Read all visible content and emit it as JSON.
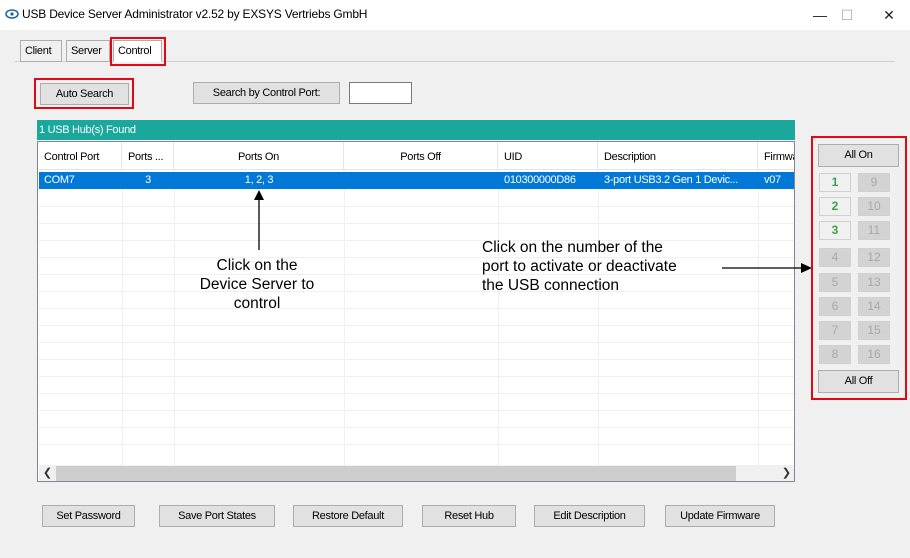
{
  "window": {
    "title": "USB Device Server Administrator v2.52 by EXSYS Vertriebs GmbH",
    "minimize": "—",
    "maximize": "☐",
    "close": "✕"
  },
  "tabs": [
    {
      "label": "Client"
    },
    {
      "label": "Server"
    },
    {
      "label": "Control",
      "active": true
    }
  ],
  "toolbar": {
    "auto_search": "Auto Search",
    "search_by_port": "Search by Control Port:",
    "port_value": ""
  },
  "found_label": "1 USB Hub(s) Found",
  "table": {
    "columns": [
      "Control Port",
      "Ports ...",
      "Ports On",
      "Ports Off",
      "UID",
      "Description",
      "Firmwa"
    ],
    "rows": [
      {
        "control_port": "COM7",
        "ports": "3",
        "ports_on": "1, 2, 3",
        "ports_off": "",
        "uid": "010300000D86",
        "description": "3-port USB3.2 Gen 1 Devic...",
        "firmware": "v07"
      }
    ]
  },
  "annotations": {
    "device_line1": "Click on the",
    "device_line2": "Device Server to",
    "device_line3": "control",
    "port_line1": "Click on the number of the",
    "port_line2": "port to activate or deactivate",
    "port_line3": "the USB connection"
  },
  "side": {
    "all_on": "All On",
    "all_off": "All Off",
    "ports": [
      {
        "num": "1",
        "on": true
      },
      {
        "num": "9",
        "on": false
      },
      {
        "num": "2",
        "on": true
      },
      {
        "num": "10",
        "on": false
      },
      {
        "num": "3",
        "on": true
      },
      {
        "num": "11",
        "on": false
      },
      {
        "num": "4",
        "on": false
      },
      {
        "num": "12",
        "on": false
      },
      {
        "num": "5",
        "on": false
      },
      {
        "num": "13",
        "on": false
      },
      {
        "num": "6",
        "on": false
      },
      {
        "num": "14",
        "on": false
      },
      {
        "num": "7",
        "on": false
      },
      {
        "num": "15",
        "on": false
      },
      {
        "num": "8",
        "on": false
      },
      {
        "num": "16",
        "on": false
      }
    ]
  },
  "bottom_buttons": {
    "set_password": "Set Password",
    "save_port_states": "Save Port States",
    "restore_default": "Restore Default",
    "reset_hub": "Reset Hub",
    "edit_description": "Edit Description",
    "update_firmware": "Update Firmware"
  },
  "colors": {
    "accent_teal": "#1aa89c",
    "selection_blue": "#0078d7",
    "highlight_red": "#e30613",
    "port_on_green": "#3aa14a"
  }
}
